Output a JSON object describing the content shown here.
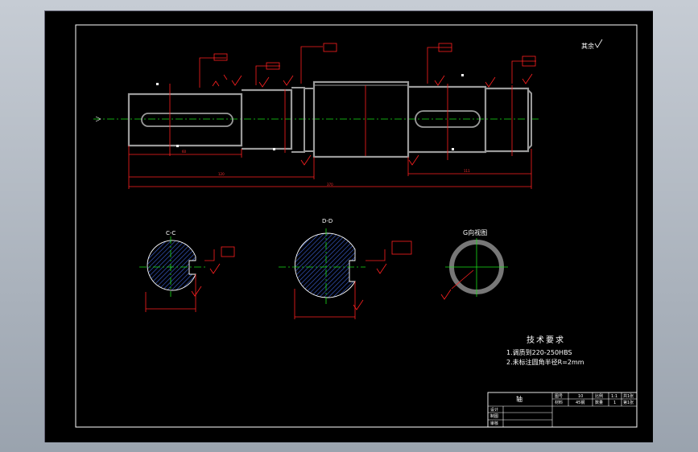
{
  "views": {
    "section_c": "C-C",
    "section_d": "D-D",
    "view_g": "G向视图"
  },
  "tech_req": {
    "title": "技术要求",
    "item1": "1.调质到220-250HBS",
    "item2": "2.未标注圆角半径R=2mm"
  },
  "title_block": {
    "part_name": "轴",
    "drawing_no_label": "图号",
    "drawing_no": "10",
    "scale_label": "比例",
    "scale": "1:1",
    "sheets_label": "共1张",
    "material_label": "材料",
    "material": "45钢",
    "quantity_label": "数量",
    "quantity": "1",
    "sheet_no_label": "第1张",
    "designer_label": "设计",
    "drafter_label": "制图",
    "reviewer_label": "审核"
  },
  "other_roughness": "其余"
}
